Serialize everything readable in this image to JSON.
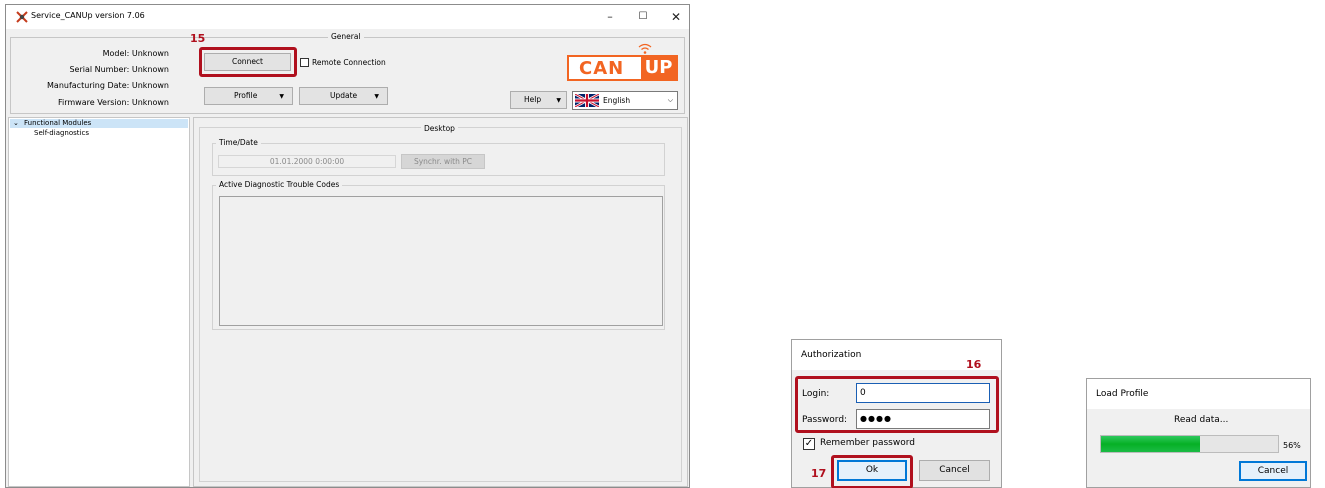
{
  "window": {
    "title": "Service_CANUp version 7.06",
    "controls": {
      "minimize": "–",
      "maximize": "☐",
      "close": "✕"
    }
  },
  "general": {
    "group_label": "General",
    "info": [
      {
        "label": "Model:",
        "value": "Unknown"
      },
      {
        "label": "Serial Number:",
        "value": "Unknown"
      },
      {
        "label": "Manufacturing Date:",
        "value": "Unknown"
      },
      {
        "label": "Firmware Version:",
        "value": "Unknown"
      }
    ],
    "connect_label": "Connect",
    "remote_label": "Remote Connection",
    "remote_checked": false,
    "profile_label": "Profile",
    "update_label": "Update",
    "help_label": "Help",
    "language": "English",
    "logo_left": "CAN",
    "logo_right": "UP"
  },
  "tree": {
    "items": [
      {
        "label": "Functional Modules",
        "expanded": true,
        "selected": true
      },
      {
        "label": "Self-diagnostics"
      }
    ]
  },
  "desktop": {
    "group_label": "Desktop",
    "timedate_label": "Time/Date",
    "datetime_value": "01.01.2000 0:00:00",
    "sync_label": "Synchr. with PC",
    "dtc_label": "Active Diagnostic Trouble Codes"
  },
  "steps": {
    "s15": "15",
    "s16": "16",
    "s17": "17"
  },
  "auth": {
    "title": "Authorization",
    "login_label": "Login:",
    "login_value": "0",
    "password_label": "Password:",
    "password_value": "●●●●",
    "remember_label": "Remember password",
    "remember_checked": true,
    "ok_label": "Ok",
    "cancel_label": "Cancel"
  },
  "load": {
    "title": "Load Profile",
    "status": "Read data...",
    "progress": 0.56,
    "percent_label": "56%",
    "cancel_label": "Cancel"
  },
  "colors": {
    "accent_red": "#b0101e",
    "logo_orange": "#f26522",
    "progress_green": "#06b025"
  }
}
